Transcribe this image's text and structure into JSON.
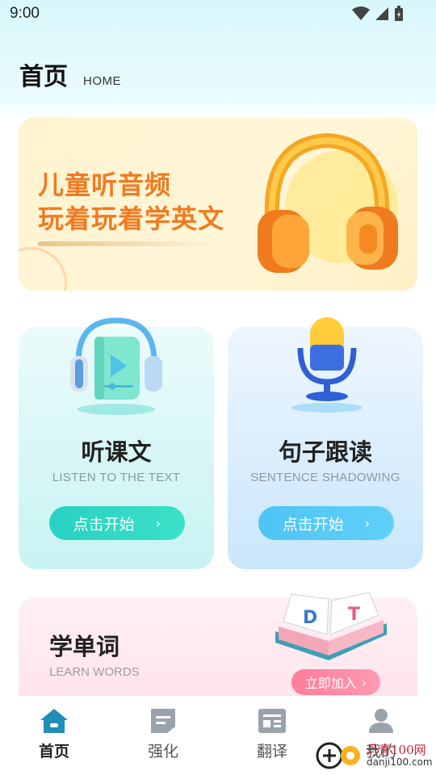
{
  "status_bar": {
    "time": "9:00"
  },
  "header": {
    "title": "首页",
    "subtitle": "HOME"
  },
  "banner": {
    "line1": "儿童听音频",
    "line2": "玩着玩着学英文"
  },
  "cards": [
    {
      "title": "听课文",
      "subtitle": "LISTEN TO THE TEXT",
      "button": "点击开始"
    },
    {
      "title": "句子跟读",
      "subtitle": "SENTENCE SHADOWING",
      "button": "点击开始"
    }
  ],
  "words": {
    "title": "学单词",
    "subtitle": "LEARN WORDS",
    "button": "立即加入"
  },
  "tabs": [
    {
      "label": "首页",
      "icon": "home-icon",
      "active": true
    },
    {
      "label": "强化",
      "icon": "note-icon"
    },
    {
      "label": "翻译",
      "icon": "translate-icon"
    },
    {
      "label": "我的",
      "icon": "user-icon"
    }
  ],
  "watermark": {
    "text": "丹青100网",
    "url": "danji100.com"
  },
  "colors": {
    "accent_teal": "#27d2c1",
    "accent_blue": "#4fc4f5",
    "accent_pink": "#ff7d9b",
    "banner_orange": "#f07a20",
    "tab_active": "#1f8fb8"
  }
}
